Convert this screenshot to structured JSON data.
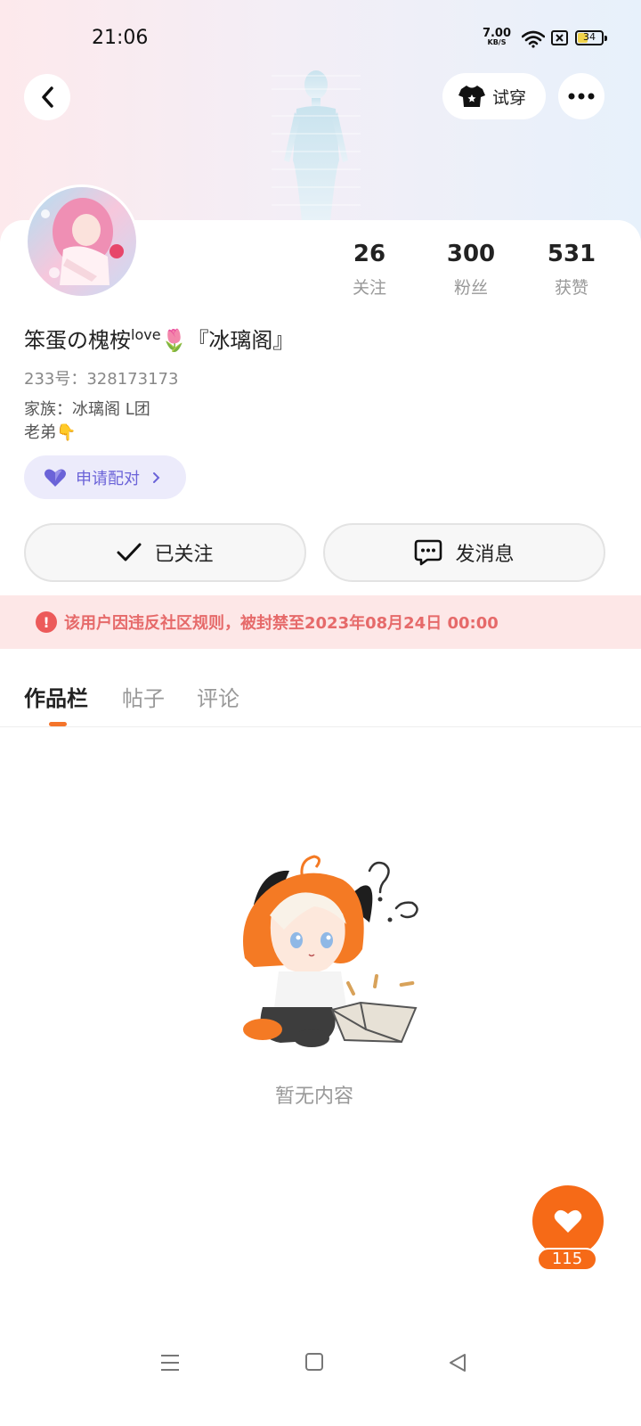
{
  "status_bar": {
    "time": "21:06",
    "net_speed": "7.00",
    "net_unit": "KB/S",
    "battery": "34"
  },
  "header": {
    "tryon_label": "试穿"
  },
  "profile": {
    "name": "笨蛋の槐桉",
    "name_sup": "love",
    "name_emoji": "🌷",
    "name_suffix": "『冰璃阁』",
    "uid": "233号：328173173",
    "bio_line1": "家族：冰璃阁 L团",
    "bio_line2": "老弟👇",
    "pair_label": "申请配对"
  },
  "stats": [
    {
      "value": "26",
      "label": "关注"
    },
    {
      "value": "300",
      "label": "粉丝"
    },
    {
      "value": "531",
      "label": "获赞"
    }
  ],
  "actions": {
    "follow_label": "已关注",
    "message_label": "发消息"
  },
  "ban_notice": "该用户因违反社区规则，被封禁至2023年08月24日 00:00",
  "tabs": [
    "作品栏",
    "帖子",
    "评论"
  ],
  "empty_text": "暂无内容",
  "like": {
    "count": "115"
  },
  "colors": {
    "accent": "#f66a17",
    "ban_text": "#e66a6a",
    "pair_text": "#6b63d8"
  }
}
